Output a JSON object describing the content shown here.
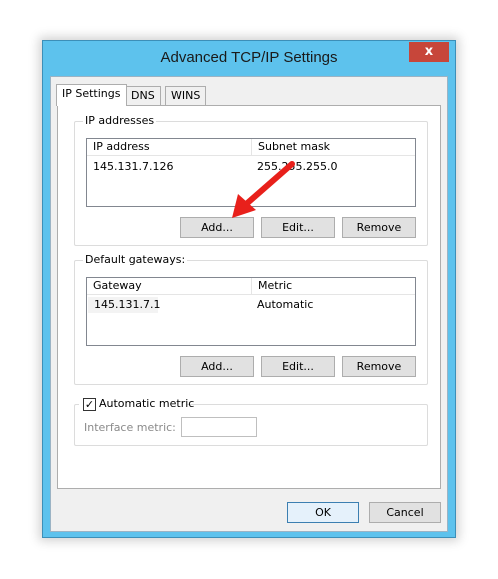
{
  "window": {
    "title": "Advanced TCP/IP Settings",
    "close_glyph": "x"
  },
  "tabs": [
    {
      "label": "IP Settings",
      "active": true
    },
    {
      "label": "DNS",
      "active": false
    },
    {
      "label": "WINS",
      "active": false
    }
  ],
  "ip_addresses": {
    "group_label": "IP addresses",
    "columns": [
      "IP address",
      "Subnet mask"
    ],
    "rows": [
      {
        "ip": "145.131.7.126",
        "mask": "255.255.255.0"
      }
    ],
    "buttons": {
      "add": "Add...",
      "edit": "Edit...",
      "remove": "Remove"
    }
  },
  "gateways": {
    "group_label": "Default gateways:",
    "columns": [
      "Gateway",
      "Metric"
    ],
    "rows": [
      {
        "gateway": "145.131.7.1",
        "metric": "Automatic"
      }
    ],
    "buttons": {
      "add": "Add...",
      "edit": "Edit...",
      "remove": "Remove"
    }
  },
  "metric": {
    "checkbox_label": "Automatic metric",
    "checked": true,
    "check_glyph": "✓",
    "interface_label": "Interface metric:",
    "interface_value": ""
  },
  "footer": {
    "ok": "OK",
    "cancel": "Cancel"
  },
  "annotation": {
    "arrow_color": "#e8201b"
  }
}
